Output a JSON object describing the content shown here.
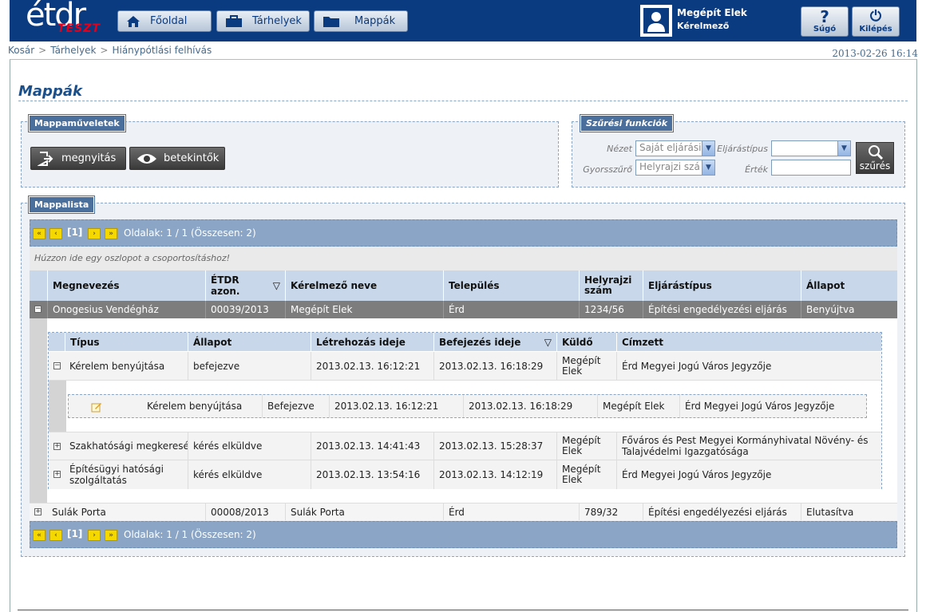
{
  "header": {
    "logo_main": "étdr",
    "logo_sub": "TESZT",
    "nav": [
      {
        "label": "Főoldal",
        "icon": "home-icon"
      },
      {
        "label": "Tárhelyek",
        "icon": "briefcase-icon"
      },
      {
        "label": "Mappák",
        "icon": "folder-icon"
      }
    ],
    "user_name": "Megépít Elek",
    "user_role": "Kérelmező",
    "help_label": "Súgó",
    "help_glyph": "?",
    "logout_label": "Kilépés",
    "logout_glyph": "⏻"
  },
  "breadcrumb": [
    "Kosár",
    "Tárhelyek",
    "Hiánypótlási felhívás"
  ],
  "breadcrumb_sep": ">",
  "datetime": "2013-02-26 16:14",
  "page_title": "Mappák",
  "actions": {
    "legend": "Mappaműveletek",
    "open_label": "megnyitás",
    "viewers_label": "betekintők"
  },
  "filter": {
    "legend": "Szűrési funkciók",
    "view_label": "Nézet",
    "view_value": "Saját eljárási",
    "proc_type_label": "Eljárástípus",
    "proc_type_value": "",
    "quick_label": "Gyorsszűrő",
    "quick_value": "Helyrajzi szá",
    "value_label": "Érték",
    "value_value": "",
    "button_label": "szűrés"
  },
  "list": {
    "legend": "Mappalista",
    "pager": {
      "first": "«",
      "prev": "‹",
      "current": "[1]",
      "next": "›",
      "last": "»",
      "info": "Oldalak: 1 / 1 (Összesen: 2)"
    },
    "group_hint": "Húzzon ide egy oszlopot a csoportosításhoz!",
    "columns": [
      "Megnevezés",
      "ÉTDR azon.",
      "Kérelmező neve",
      "Település",
      "Helyrajzi szám",
      "Eljárástípus",
      "Állapot"
    ],
    "sort_indicator": "▽",
    "rows": [
      {
        "expander": "−",
        "name": "Onogesius Vendégház",
        "id": "00039/2013",
        "applicant": "Megépít Elek",
        "town": "Érd",
        "plot": "1234/56",
        "proc": "Építési engedélyezési eljárás",
        "status": "Benyújtva"
      },
      {
        "expander": "+",
        "name": "Sulák Porta",
        "id": "00008/2013",
        "applicant": "Sulák Porta",
        "town": "Érd",
        "plot": "789/32",
        "proc": "Építési engedélyezési eljárás",
        "status": "Elutasítva"
      }
    ],
    "detail_columns": [
      "Típus",
      "Állapot",
      "Létrehozás ideje",
      "Befejezés ideje",
      "Küldő",
      "Címzett"
    ],
    "detail_rows": [
      {
        "expander": "−",
        "type": "Kérelem benyújtása",
        "status": "befejezve",
        "created": "2013.02.13. 16:12:21",
        "finished": "2013.02.13. 16:18:29",
        "sender": "Megépít Elek",
        "recipient": "Érd Megyei Jogú Város Jegyzője"
      },
      {
        "expander": "+",
        "type": "Szakhatósági megkeresés",
        "status": "kérés elküldve",
        "created": "2013.02.13. 14:41:43",
        "finished": "2013.02.13. 15:28:37",
        "sender": "Megépít Elek",
        "recipient": "Főváros és Pest Megyei Kormányhivatal Növény- és Talajvédelmi Igazgatósága"
      },
      {
        "expander": "+",
        "type": "Építésügyi hatósági szolgáltatás",
        "status": "kérés elküldve",
        "created": "2013.02.13. 13:54:16",
        "finished": "2013.02.13. 14:12:19",
        "sender": "Megépít Elek",
        "recipient": "Érd Megyei Jogú Város Jegyzője"
      }
    ],
    "sub_row": {
      "icon": "edit-note-icon",
      "type": "Kérelem benyújtása",
      "status": "Befejezve",
      "created": "2013.02.13. 16:12:21",
      "finished": "2013.02.13. 16:18:29",
      "sender": "Megépít Elek",
      "recipient": "Érd Megyei Jogú Város Jegyzője"
    }
  }
}
